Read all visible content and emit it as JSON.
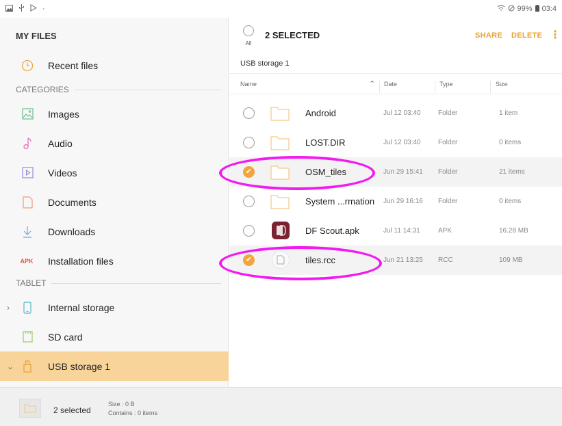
{
  "status_bar": {
    "battery": "99%",
    "time": "03:4"
  },
  "sidebar": {
    "title": "MY FILES",
    "recent_label": "Recent files",
    "categories_label": "CATEGORIES",
    "categories": [
      {
        "label": "Images",
        "icon": "image-icon"
      },
      {
        "label": "Audio",
        "icon": "music-note-icon"
      },
      {
        "label": "Videos",
        "icon": "video-icon"
      },
      {
        "label": "Documents",
        "icon": "document-icon"
      },
      {
        "label": "Downloads",
        "icon": "download-icon"
      },
      {
        "label": "Installation files",
        "icon": "apk-icon",
        "badge": "APK"
      }
    ],
    "tablet_label": "TABLET",
    "storage": [
      {
        "label": "Internal storage",
        "icon": "phone-icon"
      },
      {
        "label": "SD card",
        "icon": "sd-card-icon"
      },
      {
        "label": "USB storage 1",
        "icon": "usb-icon",
        "selected": true
      }
    ]
  },
  "toolbar": {
    "all_label": "All",
    "selected_label": "2 SELECTED",
    "share_label": "SHARE",
    "delete_label": "DELETE"
  },
  "breadcrumb": "USB storage 1",
  "columns": {
    "name": "Name",
    "date": "Date",
    "type": "Type",
    "size": "Size"
  },
  "files": [
    {
      "name": "Android",
      "date": "Jul 12 03:40",
      "type": "Folder",
      "size": "1 item",
      "checked": false,
      "kind": "folder"
    },
    {
      "name": "LOST.DIR",
      "date": "Jul 12 03:40",
      "type": "Folder",
      "size": "0 items",
      "checked": false,
      "kind": "folder"
    },
    {
      "name": "OSM_tiles",
      "date": "Jun 29 15:41",
      "type": "Folder",
      "size": "21 items",
      "checked": true,
      "kind": "folder"
    },
    {
      "name": "System ...rmation",
      "date": "Jun 29 16:16",
      "type": "Folder",
      "size": "0 items",
      "checked": false,
      "kind": "folder"
    },
    {
      "name": "DF Scout.apk",
      "date": "Jul 11 14:31",
      "type": "APK",
      "size": "16.28 MB",
      "checked": false,
      "kind": "apk"
    },
    {
      "name": "tiles.rcc",
      "date": "Jun 21 13:25",
      "type": "RCC",
      "size": "109 MB",
      "checked": true,
      "kind": "file"
    }
  ],
  "bottom": {
    "summary": "2 selected",
    "size_line": "Size : 0 B",
    "contains_line": "Contains : 0 items"
  },
  "colors": {
    "accent": "#e8a12e",
    "selected_bg": "#f8d49b",
    "annotation": "#f21af0"
  }
}
